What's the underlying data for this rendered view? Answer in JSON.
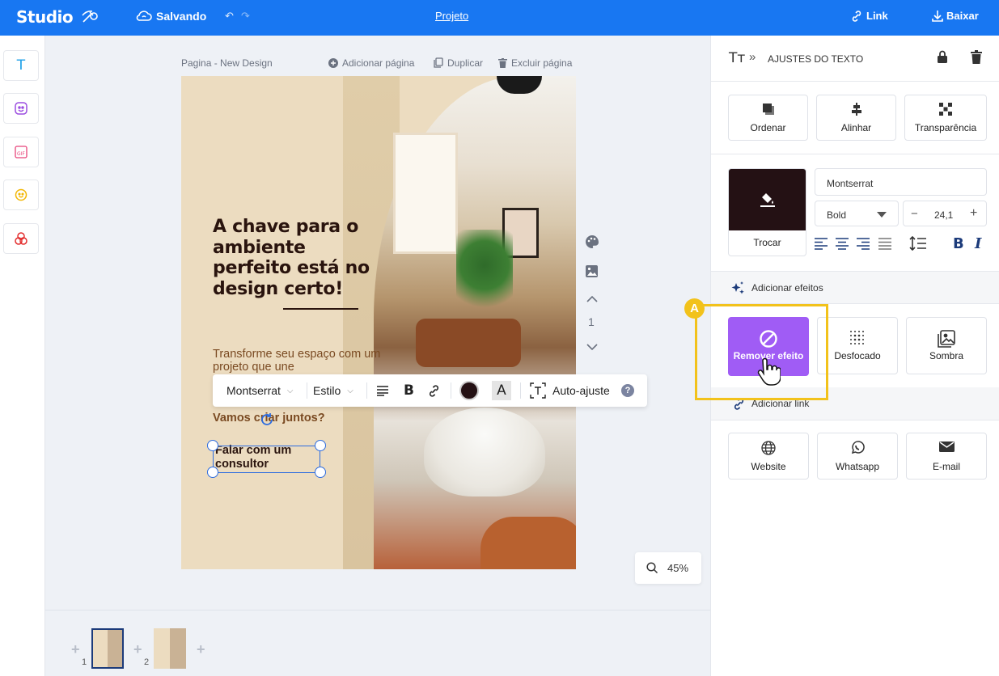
{
  "topbar": {
    "logo": "Studio",
    "status": "Salvando",
    "project_link": "Projeto",
    "link_label": "Link",
    "download_label": "Baixar"
  },
  "sidebar": {
    "tools": [
      {
        "icon": "text-icon"
      },
      {
        "icon": "sticker-icon"
      },
      {
        "icon": "gif-icon"
      },
      {
        "icon": "emoji-icon"
      },
      {
        "icon": "shapes-icon"
      }
    ]
  },
  "canvas": {
    "page_label": "Pagina - New Design",
    "add_page": "Adicionar página",
    "duplicate": "Duplicar",
    "delete_page": "Excluir página",
    "current_page": "1",
    "zoom": "45%"
  },
  "design": {
    "headline": "A chave para o ambiente perfeito está no design certo!",
    "subtitle": "Transforme seu espaço com um projeto que une",
    "cta": "Vamos criar juntos?",
    "button_text": "Falar com um consultor"
  },
  "text_toolbar": {
    "font": "Montserrat",
    "style": "Estilo",
    "auto_fit": "Auto-ajuste",
    "help": "?",
    "text_color": "#241114"
  },
  "filmstrip": {
    "pages": [
      {
        "num": "1",
        "active": true
      },
      {
        "num": "2",
        "active": false
      }
    ]
  },
  "panel": {
    "title": "AJUSTES DO TEXTO",
    "arrange": [
      "Ordenar",
      "Alinhar",
      "Transparência"
    ],
    "color_swap": "Trocar",
    "font_family": "Montserrat",
    "font_weight": "Bold",
    "font_size": "24,1",
    "effects_title": "Adicionar efeitos",
    "effects": [
      "Remover efeito",
      "Desfocado",
      "Sombra"
    ],
    "link_title": "Adicionar link",
    "links": [
      "Website",
      "Whatsapp",
      "E-mail"
    ],
    "highlight_badge": "A"
  },
  "colors": {
    "primary": "#1877f2",
    "accent": "#a05cf5",
    "highlight": "#f2c21b",
    "text_dark": "#2a140e"
  }
}
